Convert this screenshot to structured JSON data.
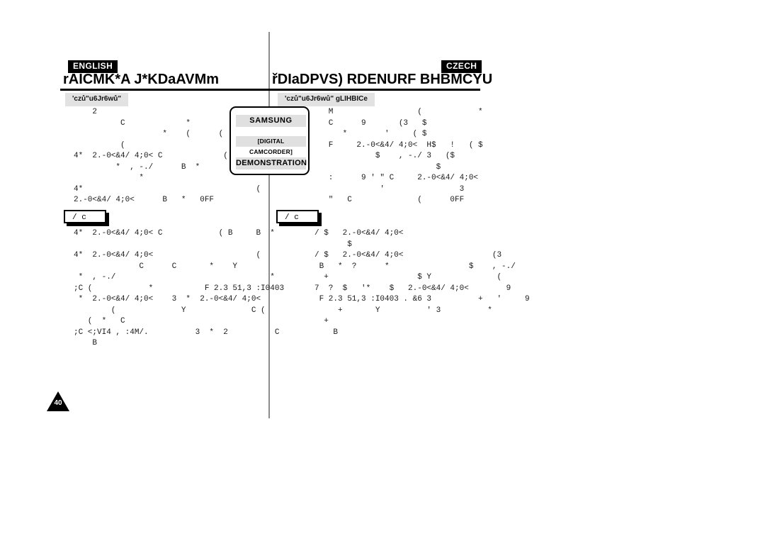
{
  "page": {
    "number": "40"
  },
  "left_column": {
    "language_tag": "ENGLISH",
    "chapter_title": "rAICMK*A J*KDaAVMm",
    "section_label": "'czů\"u6Jr6wů\"",
    "sub_box_label": "/ c",
    "body_block_1": "    2                             (  * B  (\n          C             *                       B\n                   *    (      (      *\n          (\n4*  2.-0<&4/ 4;0< C             (      (\n         *  , -./      B  *\n              *\n4*                                     (\n2.-0<&4/ 4;0<      B   *   0FF",
    "body_block_2": "4*  2.-0<&4/ 4;0< C            ( B     B  *\n\n4*  2.-0<&4/ 4;0<                      (\n              C      C       *    Y\n *  , -./                                 *\n;C (            *           F 2.3 51,3 :I0403\n *  2.-0<&4/ 4;0<    3  *  2.-0<&4/ 4;0<\n        (              Y              C (\n   (  *   C\n;C <;VI4 , :4M/.          3  *  2          C\n    B"
  },
  "right_column": {
    "language_tag": "CZECH",
    "chapter_title": "řDIaDPVS) RDENURF BHBMCYU",
    "section_label": "'czů\"u6Jr6wů\" gLIHBICe",
    "sub_box_label": "/ c",
    "body_block_1": "   M                  (            *\n   C      9       (3   $\n      *        '     ( $\n   F     2.-0<&4/ 4;0<  H$   !   ( $\n             $    , -./ 3   ($\n                          $\n   :      9 ' \" C     2.-0<&4/ 4;0<\n              '                3\n   \"   C              (      0FF",
    "body_block_2": "/ $   2.-0<&4/ 4;0<\n       $\n/ $   2.-0<&4/ 4;0<                   (3\n B   *  ?      *                 $    , -./\n  +                   $ Y              (\n7  ?  $   '*    $   2.-0<&4/ 4;0<        9\n F 2.3 51,3 :I0403 . &6 3          +   '     9\n     +       Y          ' 3          *\n  +\n    B"
  },
  "lcd_popup": {
    "line1": "SAMSUNG",
    "line2": "[DIGITAL CAMCORDER]",
    "line3": "DEMONSTRATION"
  },
  "colors": {
    "ink": "#000000",
    "divider": "#8c8c8c",
    "section_bar_bg": "#e2e2e2",
    "lcd_line_bg": "#e0e0e0",
    "paper": "#ffffff"
  }
}
